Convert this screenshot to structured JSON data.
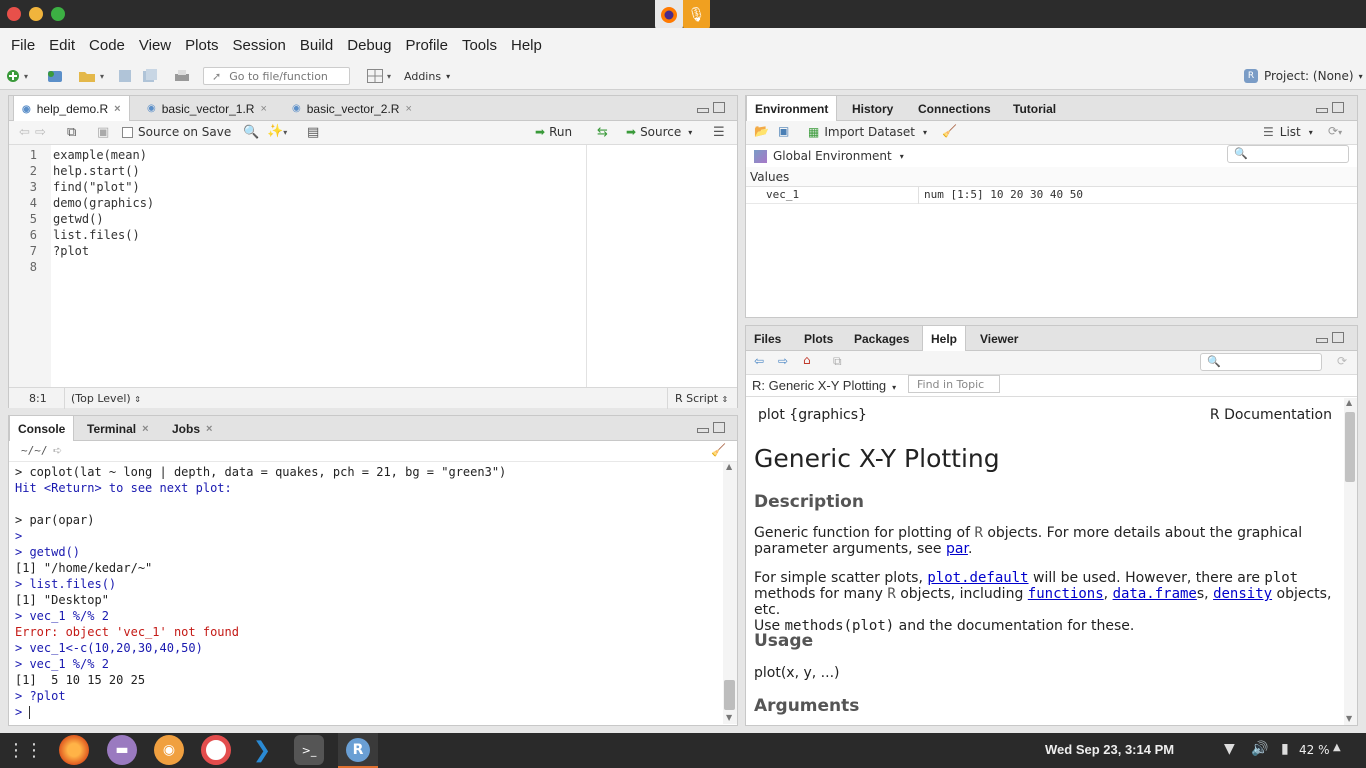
{
  "menubar": {
    "items": [
      "File",
      "Edit",
      "Code",
      "View",
      "Plots",
      "Session",
      "Build",
      "Debug",
      "Profile",
      "Tools",
      "Help"
    ]
  },
  "toolbar": {
    "goto_placeholder": "Go to file/function",
    "addins": "Addins",
    "project": "Project: (None)"
  },
  "source": {
    "tabs": [
      {
        "label": "help_demo.R",
        "active": true
      },
      {
        "label": "basic_vector_1.R",
        "active": false
      },
      {
        "label": "basic_vector_2.R",
        "active": false
      }
    ],
    "source_on_save": "Source on Save",
    "run": "Run",
    "source_btn": "Source",
    "lines": [
      "example(mean)",
      "help.start()",
      "find(\"plot\")",
      "demo(graphics)",
      "getwd()",
      "list.files()",
      "?plot",
      ""
    ],
    "line_numbers": [
      "1",
      "2",
      "3",
      "4",
      "5",
      "6",
      "7",
      "8"
    ],
    "status_pos": "8:1",
    "status_scope": "(Top Level)",
    "status_type": "R Script"
  },
  "console": {
    "tabs": [
      "Console",
      "Terminal",
      "Jobs"
    ],
    "path": "~/~/",
    "lines": [
      {
        "text": "> coplot(lat ~ long | depth, data = quakes, pch = 21, bg = \"green3\")",
        "color": "#222"
      },
      {
        "text": "Hit <Return> to see next plot:",
        "color": "#1a1ab0"
      },
      {
        "text": "",
        "color": "#222"
      },
      {
        "text": "> par(opar)",
        "color": "#222"
      },
      {
        "text": ">",
        "color": "#1a1ab0"
      },
      {
        "text": "> getwd()",
        "color": "#1a1ab0"
      },
      {
        "text": "[1] \"/home/kedar/~\"",
        "color": "#222"
      },
      {
        "text": "> list.files()",
        "color": "#1a1ab0"
      },
      {
        "text": "[1] \"Desktop\"",
        "color": "#222"
      },
      {
        "text": "> vec_1 %/% 2",
        "color": "#1a1ab0"
      },
      {
        "text": "Error: object 'vec_1' not found",
        "color": "#c41a16"
      },
      {
        "text": "> vec_1<-c(10,20,30,40,50)",
        "color": "#1a1ab0"
      },
      {
        "text": "> vec_1 %/% 2",
        "color": "#1a1ab0"
      },
      {
        "text": "[1]  5 10 15 20 25",
        "color": "#222"
      },
      {
        "text": "> ?plot",
        "color": "#1a1ab0"
      },
      {
        "text": "> ",
        "color": "#1a1ab0"
      }
    ]
  },
  "environment": {
    "tabs": [
      "Environment",
      "History",
      "Connections",
      "Tutorial"
    ],
    "import_dataset": "Import Dataset",
    "view_mode": "List",
    "scope": "Global Environment",
    "section": "Values",
    "rows": [
      {
        "name": "vec_1",
        "value": "num [1:5] 10 20 30 40 50"
      }
    ]
  },
  "help": {
    "tabs": [
      "Files",
      "Plots",
      "Packages",
      "Help",
      "Viewer"
    ],
    "topic": "R: Generic X-Y Plotting",
    "find_placeholder": "Find in Topic",
    "header_left": "plot {graphics}",
    "header_right": "R Documentation",
    "title": "Generic X-Y Plotting",
    "description_h": "Description",
    "desc_p1a": "Generic function for plotting of",
    "desc_p1_r": "R",
    "desc_p1b": "objects. For more details about the graphical",
    "desc_p1c": "parameter arguments, see",
    "desc_p1_link": "par",
    "desc_p2a": "For simple scatter plots,",
    "desc_p2_link1": "plot.default",
    "desc_p2b": "will be used. However, there are",
    "desc_p2_code1": "plot",
    "desc_p2c": "methods for many",
    "desc_p2_r": "R",
    "desc_p2d": "objects, including",
    "desc_p2_link2": "functions",
    "desc_p2_link3": "data.frame",
    "desc_p2_link4": "density",
    "desc_p2e": "objects, etc.",
    "desc_p2f": "Use",
    "desc_p2_code2": "methods(plot)",
    "desc_p2g": "and the documentation for these.",
    "usage_h": "Usage",
    "usage_code": "plot(x, y, ...)",
    "arguments_h": "Arguments"
  },
  "taskbar": {
    "datetime": "Wed Sep 23,  3:14 PM",
    "battery": "42 %"
  }
}
